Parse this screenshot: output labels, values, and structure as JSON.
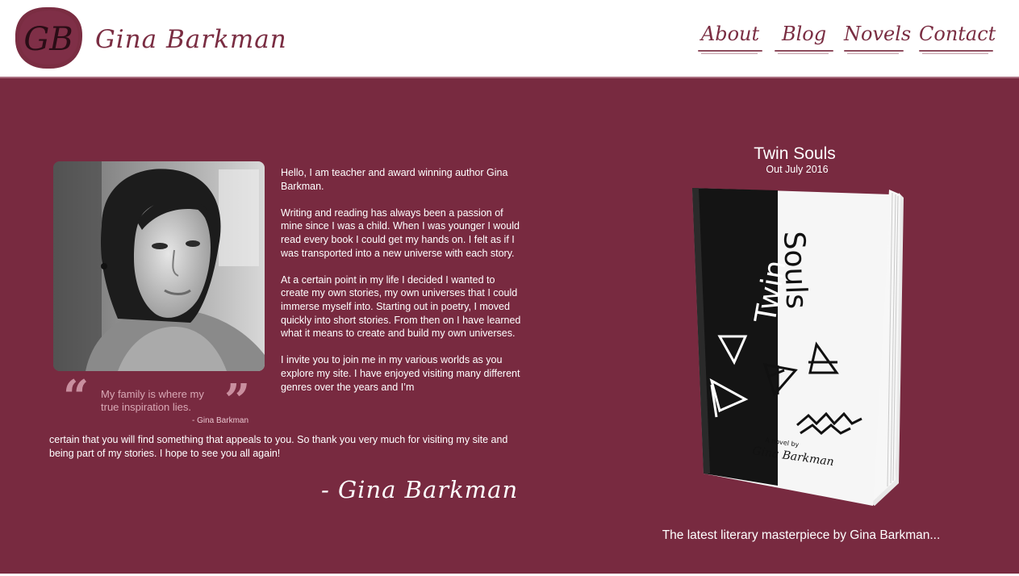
{
  "header": {
    "logo_text": "GB",
    "brand": "Gina Barkman",
    "nav": [
      {
        "label": "About"
      },
      {
        "label": "Blog"
      },
      {
        "label": "Novels"
      },
      {
        "label": "Contact"
      }
    ]
  },
  "profile": {
    "quote": "My family is where my true inspiration lies.",
    "quote_attribution": "- Gina Barkman",
    "quote_open": "“",
    "quote_close": "”"
  },
  "bio": {
    "paragraphs": [
      "Hello, I am teacher and award winning author Gina Barkman.",
      "Writing and reading has always been a passion of mine since I was a child. When I was younger I would read every book I could get my hands on. I felt as if I was transported into a new universe with each story.",
      "At a certain point in my life I decided I wanted to create my own stories, my own universes that I could immerse myself into. Starting out in poetry, I moved quickly into short stories. From then on I have learned what it means to create and build my own universes.",
      "I invite you to join me in my various worlds as you explore my site. I have enjoyed visiting many different genres over the years and I’m"
    ],
    "continuation": "certain that you will find something that appeals to you. So thank you very much for visiting my site and being part of my stories. I hope to see you all again!",
    "signature": "- Gina Barkman"
  },
  "book": {
    "title": "Twin Souls",
    "release": "Out July 2016",
    "cover_title_left": "Twin",
    "cover_title_right": "Souls",
    "cover_byline": "A novel by",
    "cover_author": "Gina Barkman",
    "tagline": "The latest literary masterpiece by Gina Barkman..."
  },
  "colors": {
    "brand": "#782a40",
    "accent": "#7a2d42",
    "quote": "#d9a9b6"
  }
}
